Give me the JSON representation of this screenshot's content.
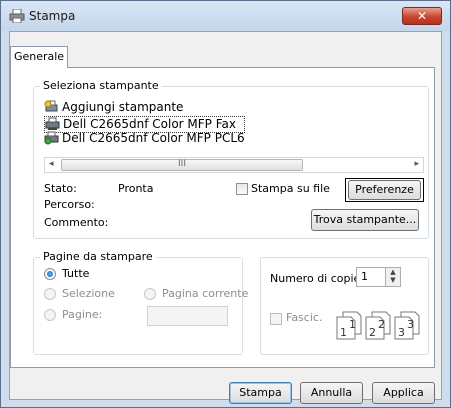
{
  "window": {
    "title": "Stampa",
    "close_label": "✕"
  },
  "tabs": [
    {
      "label": "Generale"
    }
  ],
  "printer_group": {
    "legend": "Seleziona stampante",
    "items": [
      {
        "label": "Aggiungi stampante",
        "icon": "add-printer-icon"
      },
      {
        "label": "Dell C2665dnf Color MFP Fax",
        "icon": "fax-printer-icon",
        "selected": true
      },
      {
        "label": "Dell C2665dnf Color MFP PCL6",
        "icon": "default-printer-icon"
      }
    ],
    "scroll_thumb": "III",
    "status_label": "Stato:",
    "status_value": "Pronta",
    "path_label": "Percorso:",
    "comment_label": "Commento:",
    "print_to_file_label": "Stampa su file",
    "preferences_label": "Preferenze",
    "find_printer_label": "Trova stampante..."
  },
  "pages_group": {
    "legend": "Pagine da stampare",
    "all": "Tutte",
    "selection": "Selezione",
    "current_page": "Pagina corrente",
    "pages": "Pagine:",
    "selected_option": "Tutte"
  },
  "copies_group": {
    "copies_label": "Numero di copie:",
    "copies_value": "1",
    "collate_label": "Fascic."
  },
  "footer": {
    "print_label": "Stampa",
    "cancel_label": "Annulla",
    "apply_label": "Applica"
  },
  "colors": {
    "selected_radio": "#1b67b5",
    "close_button": "#c8452f"
  }
}
